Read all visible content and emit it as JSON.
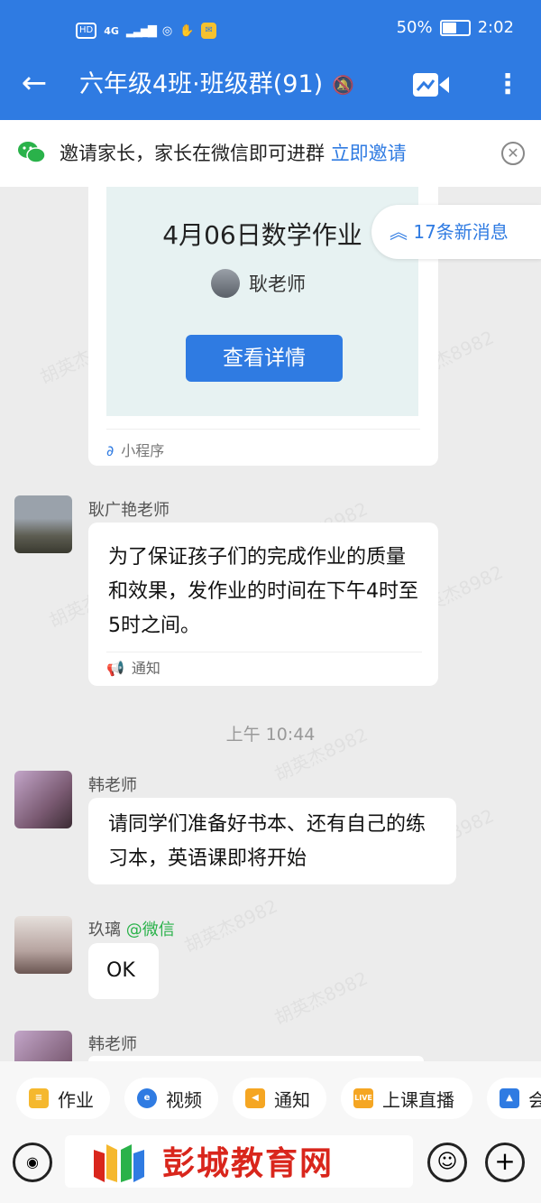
{
  "status_bar": {
    "hd": "HD",
    "network": "4G",
    "battery_text": "50%",
    "battery_level": 0.5,
    "time": "2:02"
  },
  "header": {
    "back_icon": "back-arrow-icon",
    "title": "六年级4班·班级群(91)",
    "mute_icon": "bell-muted-icon",
    "video_icon": "video-camera-icon",
    "more_icon": "more-vertical-icon"
  },
  "invite_banner": {
    "text": "邀请家长，家长在微信即可进群",
    "link": "立即邀请"
  },
  "miniprogram_card": {
    "title": "4月06日数学作业",
    "teacher": "耿老师",
    "button": "查看详情",
    "footer": "小程序"
  },
  "new_messages": "17条新消息",
  "messages": [
    {
      "sender": "耿广艳老师",
      "text": "为了保证孩子们的完成作业的质量和效果，发作业的时间在下午4时至5时之间。",
      "tag": "通知"
    },
    {
      "sender": "韩老师",
      "text": "请同学们准备好书本、还有自己的练习本，英语课即将开始"
    },
    {
      "sender": "玖璃",
      "sender_suffix": "@微信",
      "text": "OK"
    },
    {
      "sender": "韩老师"
    }
  ],
  "time_divider": "上午 10:44",
  "watermark": "胡英杰8982",
  "shortcuts": [
    {
      "label": "作业",
      "icon": "homework-icon"
    },
    {
      "label": "视频",
      "icon": "video-icon"
    },
    {
      "label": "通知",
      "icon": "megaphone-icon"
    },
    {
      "label": "上课直播",
      "icon": "live-icon",
      "badge": "LIVE"
    },
    {
      "label": "会",
      "icon": "meeting-icon"
    }
  ],
  "footer_logo": "彭城教育网",
  "colors": {
    "accent": "#2f7be2",
    "wechat_green": "#2ab24a",
    "logo_red": "#d9261c"
  }
}
